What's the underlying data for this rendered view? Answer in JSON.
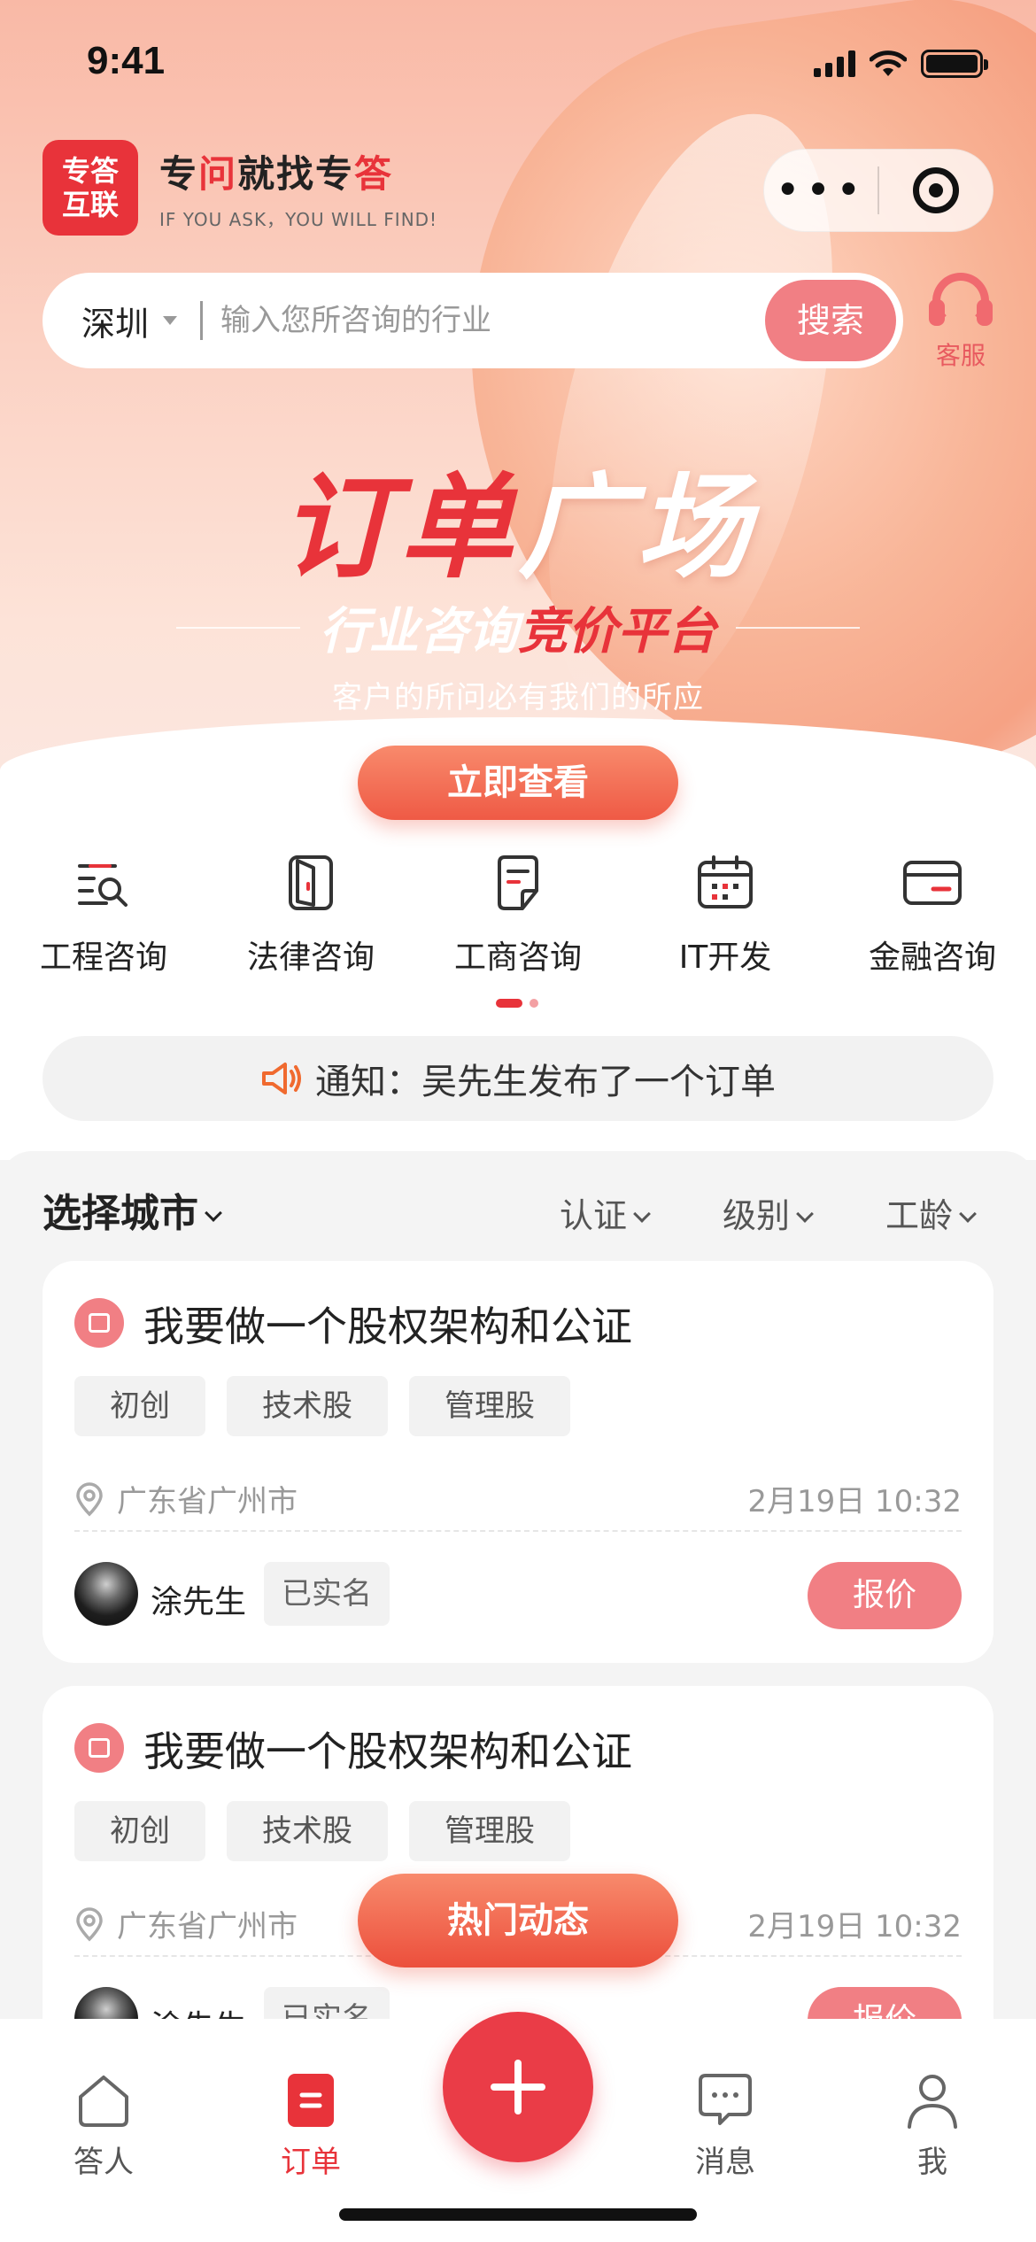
{
  "status": {
    "time": "9:41"
  },
  "brand": {
    "logo_line1": "专答",
    "logo_line2": "互联",
    "slogan_p1": "专",
    "slogan_p2": "问",
    "slogan_p3": "就找专",
    "slogan_p4": "答",
    "subtitle": "IF YOU ASK，YOU WILL FIND!"
  },
  "capsule": {
    "more": "•••"
  },
  "search": {
    "city": "深圳",
    "placeholder": "输入您所咨询的行业",
    "button": "搜索"
  },
  "service": {
    "label": "客服"
  },
  "banner": {
    "title_red": "订单",
    "title_white": "广场",
    "sub_white": "行业咨询",
    "sub_red": "竞价平台",
    "tagline": "客户的所问必有我们的所应",
    "cta": "立即查看"
  },
  "categories": [
    {
      "label": "工程咨询",
      "icon": "search-list-icon"
    },
    {
      "label": "法律咨询",
      "icon": "door-icon"
    },
    {
      "label": "工商咨询",
      "icon": "document-icon"
    },
    {
      "label": "IT开发",
      "icon": "calendar-icon"
    },
    {
      "label": "金融咨询",
      "icon": "card-icon"
    }
  ],
  "notice": {
    "text": "通知：吴先生发布了一个订单"
  },
  "filters": {
    "city": "选择城市",
    "opt1": "认证",
    "opt2": "级别",
    "opt3": "工龄"
  },
  "orders": [
    {
      "title": "我要做一个股权架构和公证",
      "tags": [
        "初创",
        "技术股",
        "管理股"
      ],
      "location": "广东省广州市",
      "date": "2月19日 10:32",
      "name": "涂先生",
      "badge": "已实名",
      "quote": "报价"
    },
    {
      "title": "我要做一个股权架构和公证",
      "tags": [
        "初创",
        "技术股",
        "管理股"
      ],
      "location": "广东省广州市",
      "date": "2月19日 10:32",
      "name": "涂先生",
      "badge": "已实名",
      "quote": "报价"
    }
  ],
  "hot_button": "热门动态",
  "tabs": [
    {
      "label": "答人",
      "icon": "home-icon"
    },
    {
      "label": "订单",
      "icon": "order-icon",
      "active": true
    },
    {
      "label": "消息",
      "icon": "message-icon"
    },
    {
      "label": "我",
      "icon": "user-icon"
    }
  ],
  "colors": {
    "brand": "#e8333a",
    "accent": "#f17f84"
  }
}
